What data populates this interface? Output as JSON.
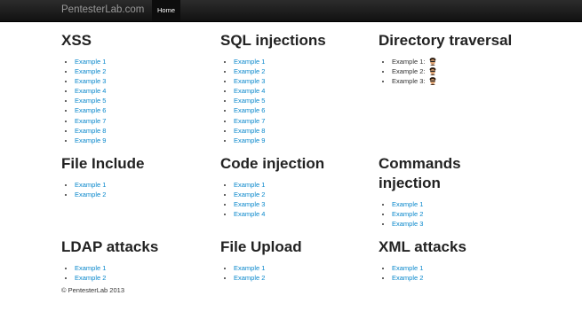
{
  "navbar": {
    "brand": "PentesterLab.com",
    "home": "Home"
  },
  "sections": [
    {
      "title": "XSS",
      "examples": [
        "Example 1",
        "Example 2",
        "Example 3",
        "Example 4",
        "Example 5",
        "Example 6",
        "Example 7",
        "Example 8",
        "Example 9"
      ]
    },
    {
      "title": "SQL injections",
      "examples": [
        "Example 1",
        "Example 2",
        "Example 3",
        "Example 4",
        "Example 5",
        "Example 6",
        "Example 7",
        "Example 8",
        "Example 9"
      ]
    },
    {
      "title": "Directory traversal",
      "examples": [
        "Example 1:",
        "Example 2:",
        "Example 3:"
      ]
    },
    {
      "title": "File Include",
      "examples": [
        "Example 1",
        "Example 2"
      ]
    },
    {
      "title": "Code injection",
      "examples": [
        "Example 1",
        "Example 2",
        "Example 3",
        "Example 4"
      ]
    },
    {
      "title": "Commands injection",
      "examples": [
        "Example 1",
        "Example 2",
        "Example 3"
      ]
    },
    {
      "title": "LDAP attacks",
      "examples": [
        "Example 1",
        "Example 2"
      ]
    },
    {
      "title": "File Upload",
      "examples": [
        "Example 1",
        "Example 2"
      ]
    },
    {
      "title": "XML attacks",
      "examples": [
        "Example 1",
        "Example 2"
      ]
    }
  ],
  "footer": "© PentesterLab 2013",
  "colors": {
    "link": "#0a88cc",
    "navbar": "#1b1b1b"
  },
  "icons": {
    "traversal_image": "person-face-icon"
  }
}
